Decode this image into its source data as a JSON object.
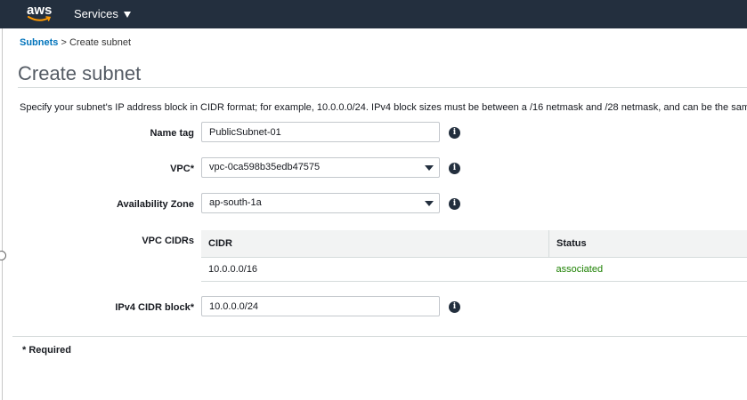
{
  "header": {
    "logo_text": "aws",
    "services_label": "Services"
  },
  "breadcrumb": {
    "parent": "Subnets",
    "separator": ">",
    "current": "Create subnet"
  },
  "page": {
    "title": "Create subnet",
    "description": "Specify your subnet's IP address block in CIDR format; for example, 10.0.0.0/24. IPv4 block sizes must be between a /16 netmask and /28 netmask, and can be the same s"
  },
  "form": {
    "name_tag": {
      "label": "Name tag",
      "value": "PublicSubnet-01"
    },
    "vpc": {
      "label": "VPC*",
      "value": "vpc-0ca598b35edb47575"
    },
    "availability_zone": {
      "label": "Availability Zone",
      "value": "ap-south-1a"
    },
    "vpc_cidrs": {
      "label": "VPC CIDRs",
      "columns": [
        "CIDR",
        "Status"
      ],
      "rows": [
        {
          "cidr": "10.0.0.0/16",
          "status": "associated"
        }
      ]
    },
    "ipv4_cidr": {
      "label": "IPv4 CIDR block*",
      "value": "10.0.0.0/24"
    }
  },
  "footer": {
    "required_note": "* Required"
  },
  "colors": {
    "topbar": "#232f3e",
    "link": "#0073bb",
    "status_ok": "#1d8102"
  },
  "icons": [
    "aws-logo-icon",
    "caret-down-icon",
    "info-icon",
    "chevron-down-icon"
  ]
}
